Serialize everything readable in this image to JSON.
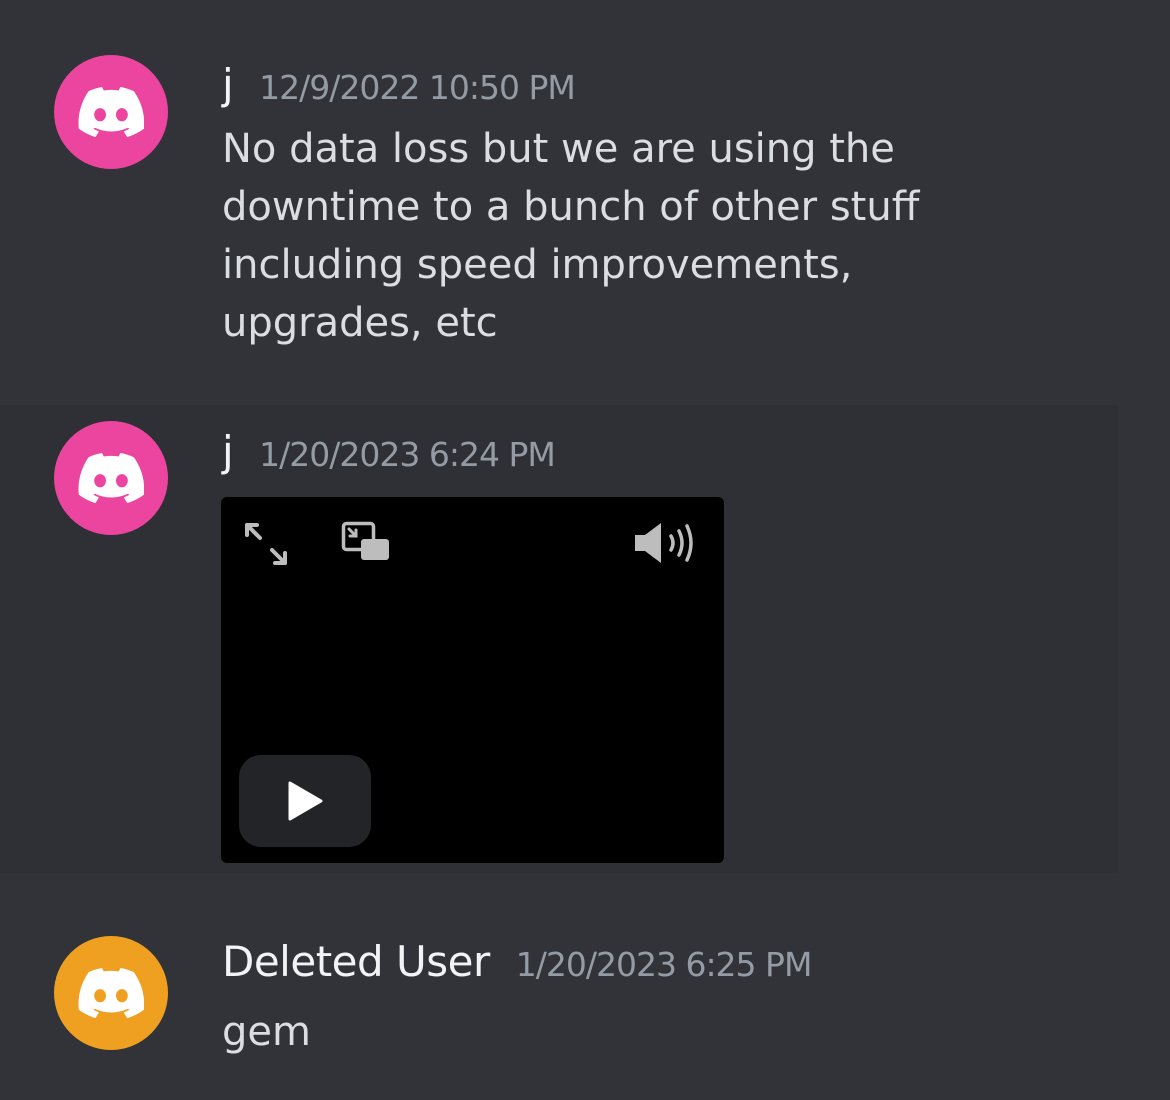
{
  "messages": [
    {
      "username": "j",
      "timestamp": "12/9/2022 10:50 PM",
      "content": "No data loss but we are using the downtime to a bunch of other stuff including speed improvements, upgrades, etc",
      "avatar_color": "#eb459f"
    },
    {
      "username": "j",
      "timestamp": "1/20/2023 6:24 PM",
      "avatar_color": "#eb459f",
      "attachment": {
        "type": "video",
        "controls": [
          "fullscreen-icon",
          "picture-in-picture-icon",
          "volume-icon",
          "play-icon"
        ]
      }
    },
    {
      "username": "Deleted User",
      "timestamp": "1/20/2023 6:25 PM",
      "content": "gem",
      "avatar_color": "#f0a020"
    }
  ],
  "colors": {
    "background": "#313338",
    "hover_background": "#2e3035",
    "username": "#f2f3f5",
    "timestamp": "#949ba4",
    "text": "#dbdee1"
  }
}
